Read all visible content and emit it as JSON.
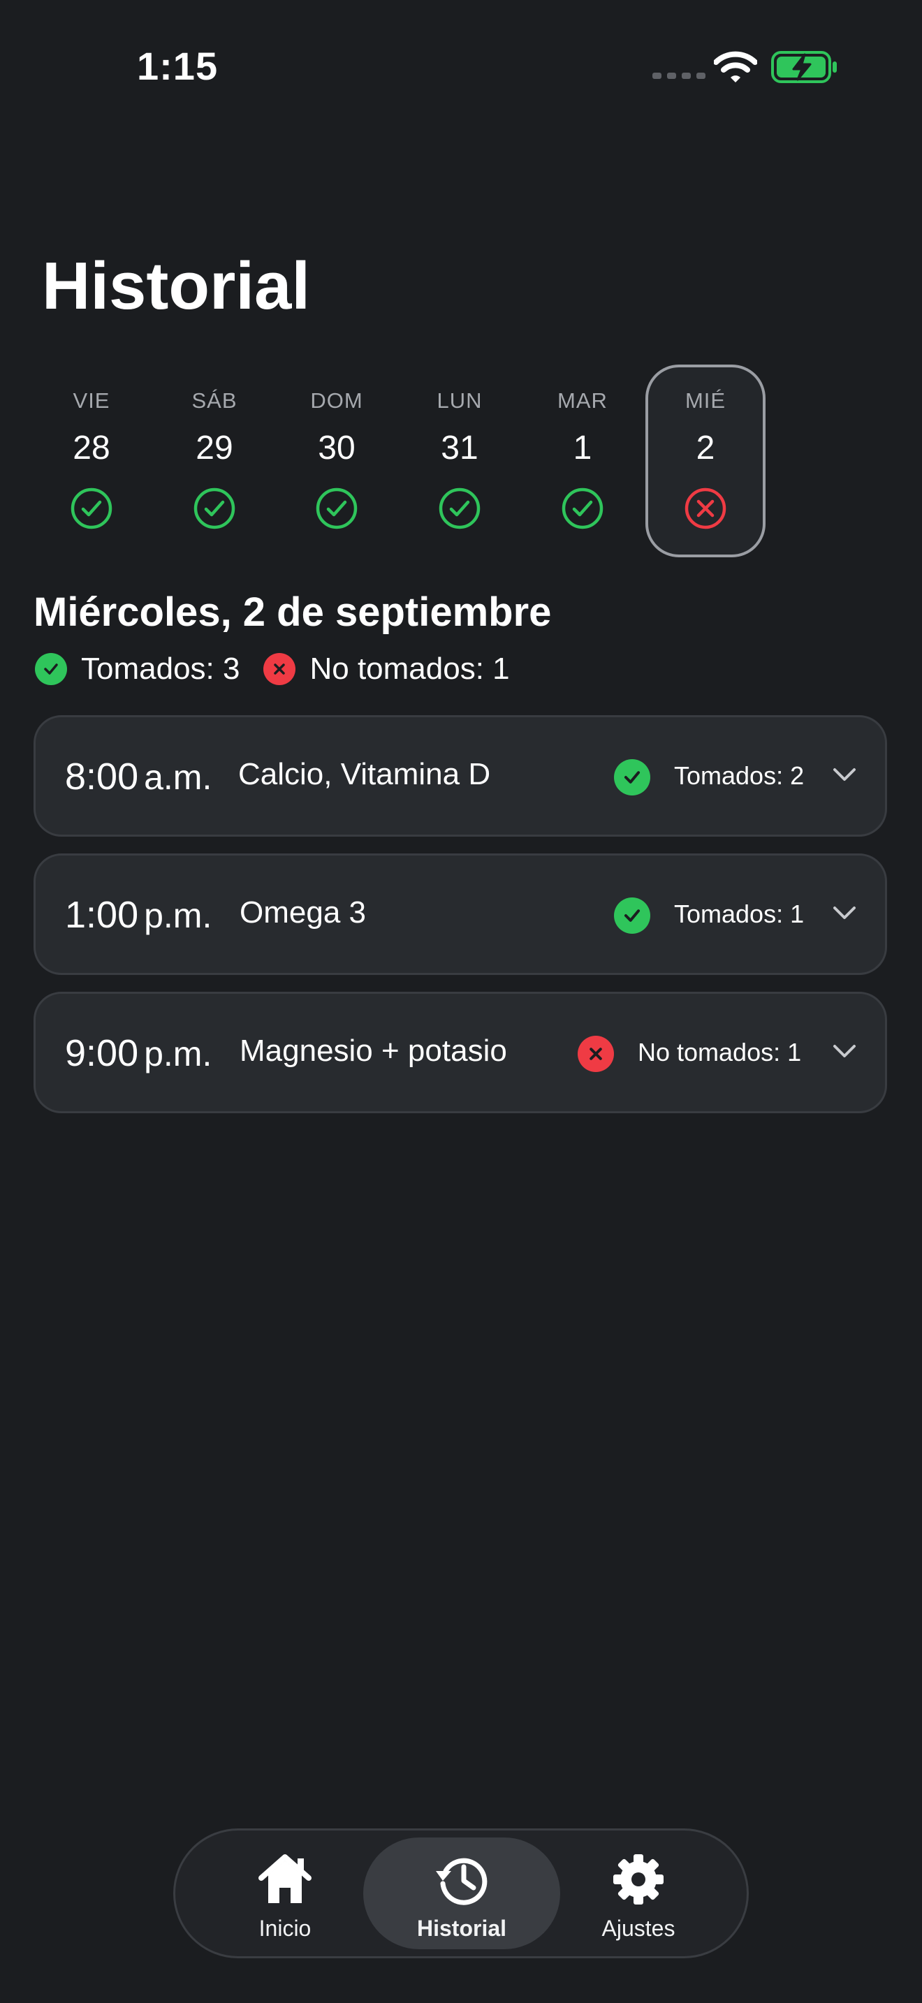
{
  "status_bar": {
    "time": "1:15"
  },
  "title": "Historial",
  "days": [
    {
      "name": "VIE",
      "number": "28",
      "status": "taken"
    },
    {
      "name": "SÁB",
      "number": "29",
      "status": "taken"
    },
    {
      "name": "DOM",
      "number": "30",
      "status": "taken"
    },
    {
      "name": "LUN",
      "number": "31",
      "status": "taken"
    },
    {
      "name": "MAR",
      "number": "1",
      "status": "taken"
    },
    {
      "name": "MIÉ",
      "number": "2",
      "status": "missed",
      "selected": true
    }
  ],
  "selected_date": "Miércoles, 2 de septiembre",
  "summary": {
    "taken_label": "Tomados: 3",
    "missed_label": "No tomados: 1"
  },
  "doses": [
    {
      "time": "8:00",
      "ampm": "a.m.",
      "meds": "Calcio, Vitamina D",
      "status": "taken",
      "status_text": "Tomados: 2"
    },
    {
      "time": "1:00",
      "ampm": "p.m.",
      "meds": "Omega 3",
      "status": "taken",
      "status_text": "Tomados: 1"
    },
    {
      "time": "9:00",
      "ampm": "p.m.",
      "meds": "Magnesio + potasio",
      "status": "missed",
      "status_text": "No tomados: 1"
    }
  ],
  "tabs": [
    {
      "label": "Inicio",
      "icon": "home-icon"
    },
    {
      "label": "Historial",
      "icon": "history-icon",
      "active": true
    },
    {
      "label": "Ajustes",
      "icon": "gear-icon"
    }
  ],
  "colors": {
    "background": "#1b1d20",
    "card": "#282b2f",
    "taken": "#2fc55b",
    "missed": "#ef3b44"
  }
}
